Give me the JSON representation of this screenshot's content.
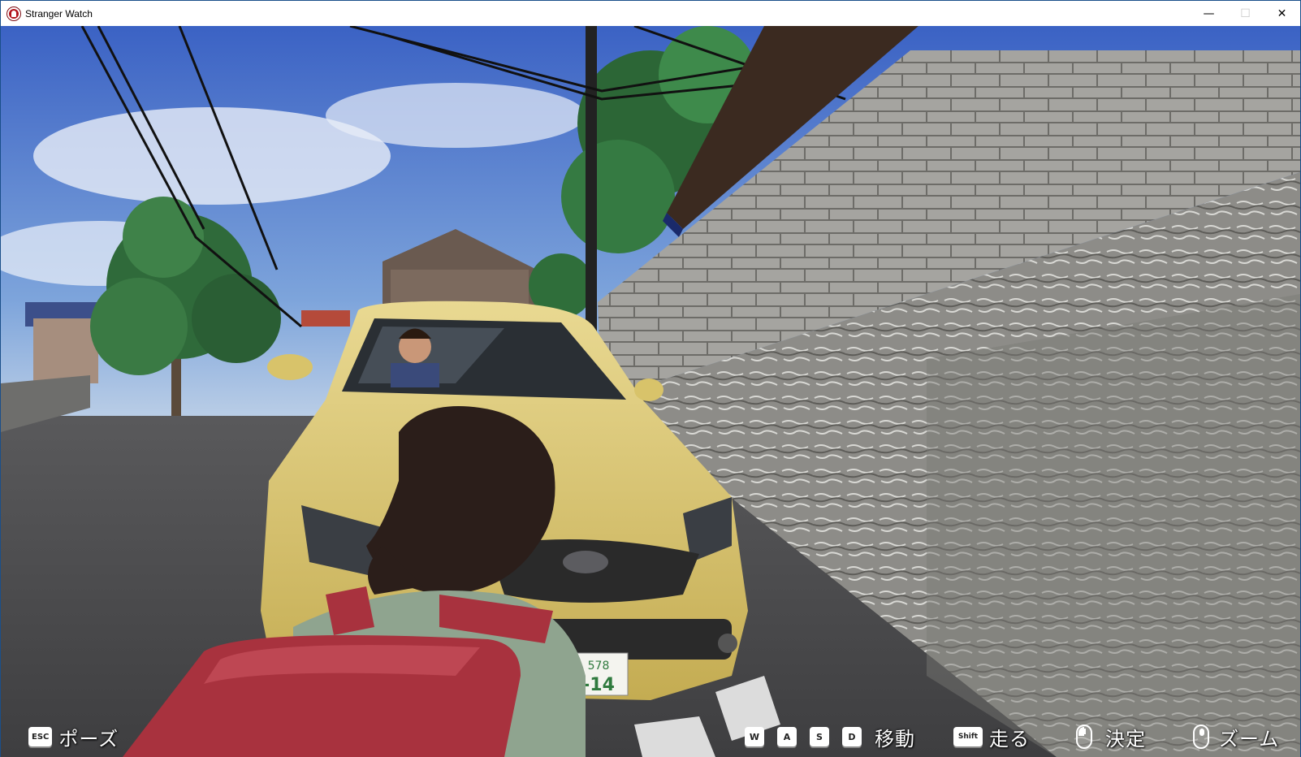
{
  "window": {
    "title": "Stranger Watch",
    "minimize": "—",
    "maximize": "☐",
    "close": "✕"
  },
  "scene": {
    "license_plate_top": "578",
    "license_plate_main": "-14"
  },
  "hud": {
    "pause": {
      "key": "ESC",
      "label": "ポーズ"
    },
    "move": {
      "keys": [
        "W",
        "A",
        "S",
        "D"
      ],
      "label": "移動"
    },
    "run": {
      "key": "Shift",
      "label": "走る"
    },
    "confirm": {
      "icon": "mouse-left-click-icon",
      "label": "決定"
    },
    "zoom": {
      "icon": "mouse-wheel-icon",
      "label": "ズーム"
    }
  },
  "colors": {
    "sky": "#4a74c9",
    "car_body": "#d8c36a",
    "wall": "#9a9a96",
    "road": "#4a4a4c",
    "backpack": "#a8323e"
  }
}
